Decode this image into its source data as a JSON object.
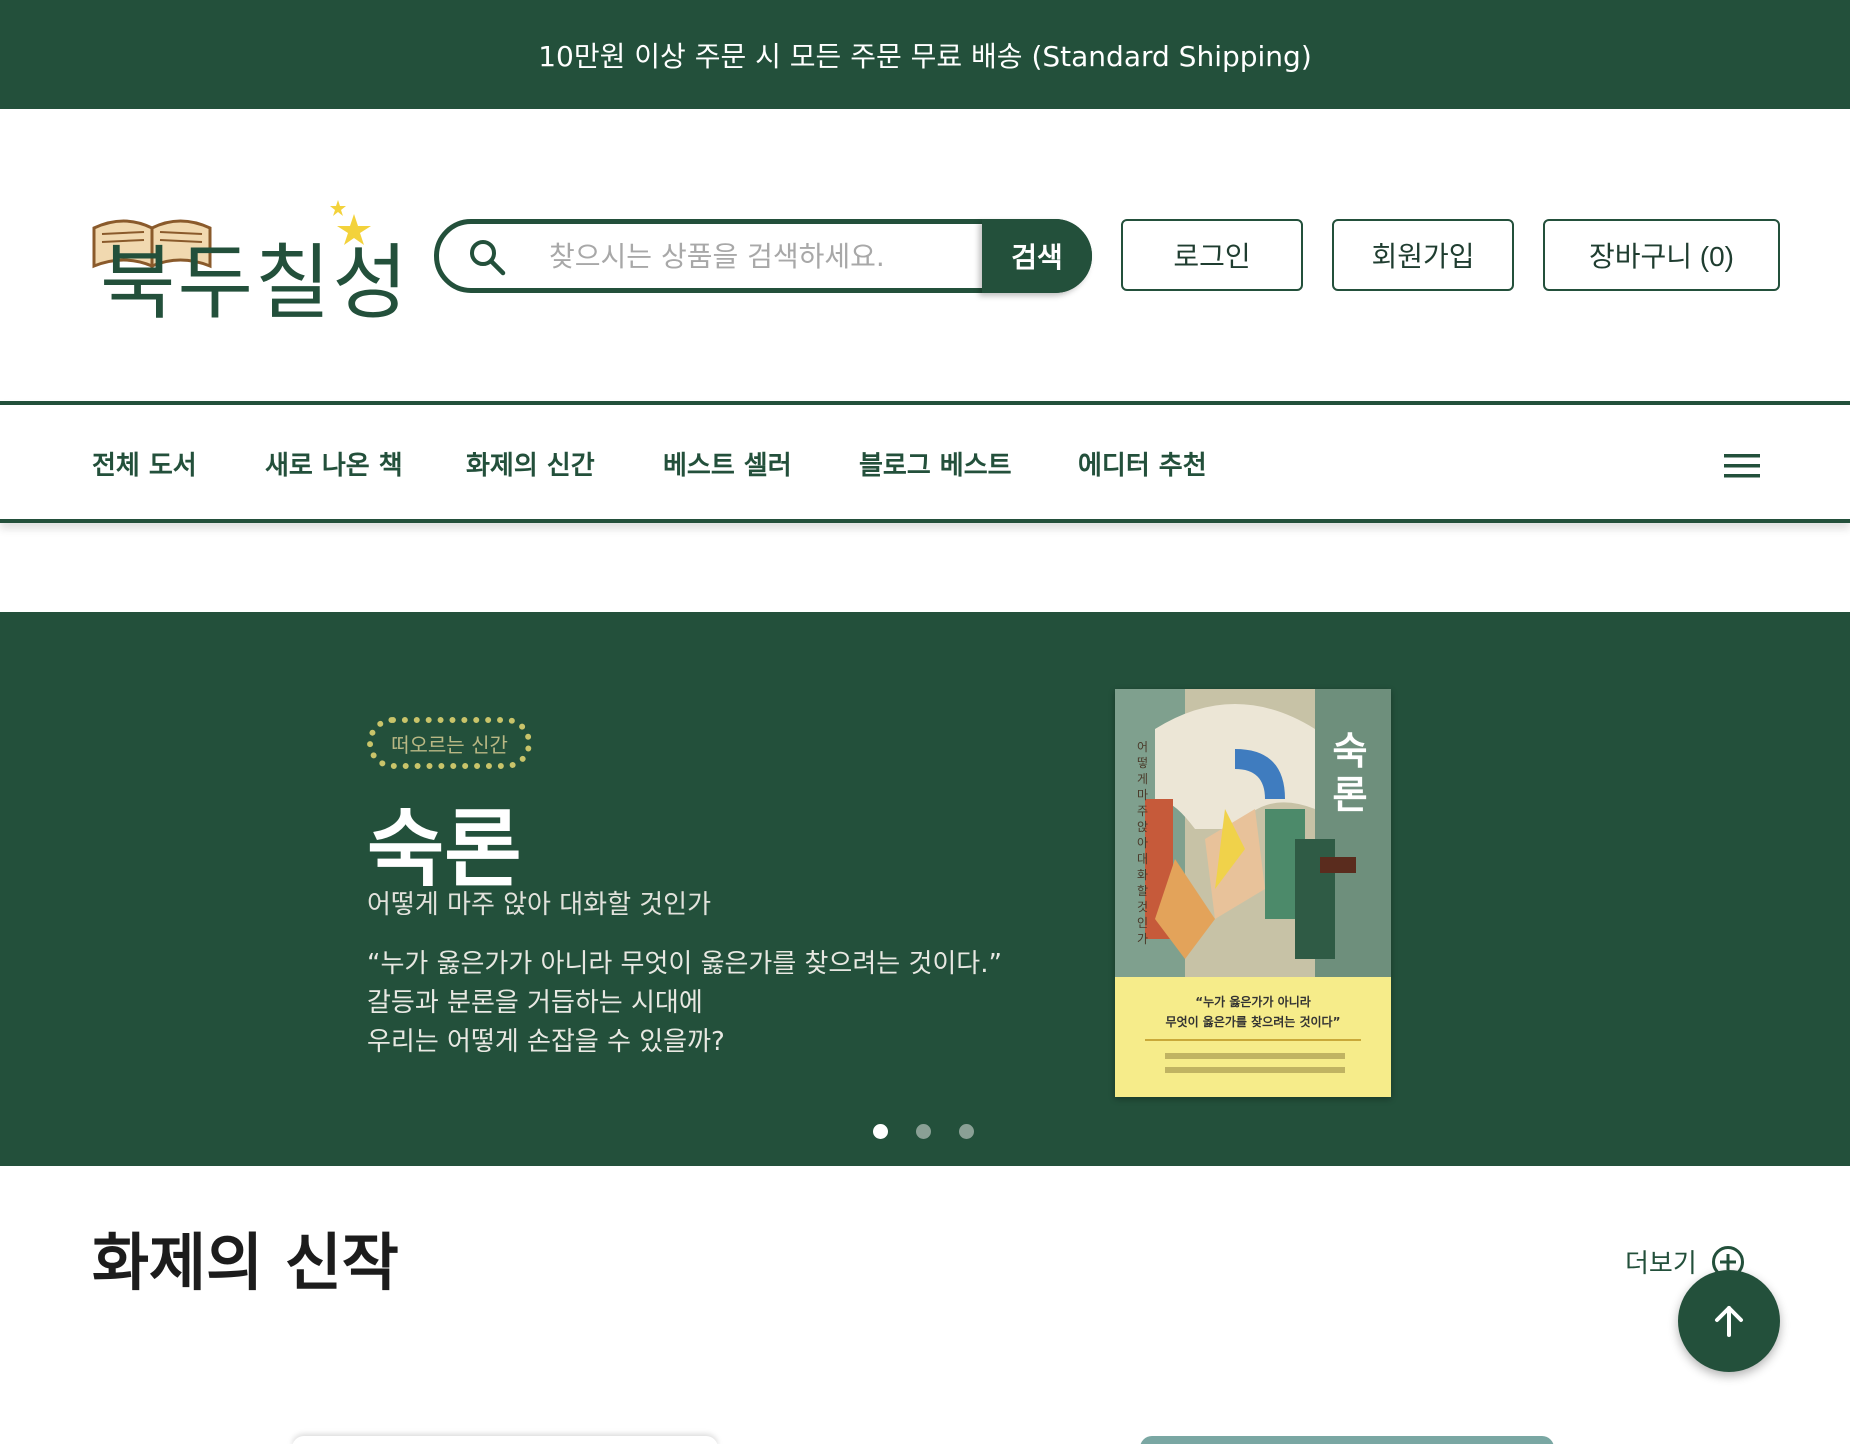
{
  "topbar": {
    "text": "10만원 이상 주문 시 모든 주문 무료 배송 (Standard Shipping)"
  },
  "header": {
    "logo_text": "북두칠성",
    "search": {
      "placeholder": "찾으시는 상품을 검색하세요.",
      "button_label": "검색"
    },
    "login_label": "로그인",
    "signup_label": "회원가입",
    "cart_label": "장바구니 (0)"
  },
  "nav": {
    "items": [
      {
        "label": "전체 도서"
      },
      {
        "label": "새로 나온 책"
      },
      {
        "label": "화제의 신간"
      },
      {
        "label": "베스트 셀러"
      },
      {
        "label": "블로그 베스트"
      },
      {
        "label": "에디터 추천"
      }
    ],
    "menu_icon": "hamburger-icon"
  },
  "hero": {
    "tag": "떠오르는 신간",
    "title": "숙론",
    "subtitle": "어떻게 마주 앉아 대화할 것인가",
    "quote_lines": [
      "“누가 옳은가가 아니라 무엇이 옳은가를 찾으려는 것이다.”",
      "갈등과 분론을 거듭하는 시대에",
      "우리는 어떻게 손잡을 수 있을까?"
    ],
    "cover": {
      "title": "숙론",
      "vertical_text": "어떻게 마주 앉아 대화할 것인가",
      "band_line1": "“누가 옳은가가 아니라",
      "band_line2": "무엇이 옳은가를 찾으려는 것이다”"
    },
    "slides_total": 3,
    "active_slide": 1
  },
  "section": {
    "title": "화제의 신작",
    "more_label": "더보기"
  },
  "colors": {
    "brand": "#23503b",
    "accent_yellow": "#f6ec8a",
    "tag_dotted": "#c9c46a"
  },
  "icons": {
    "search": "search-icon",
    "more": "plus-circle-icon",
    "scroll_top": "arrow-up-icon"
  }
}
